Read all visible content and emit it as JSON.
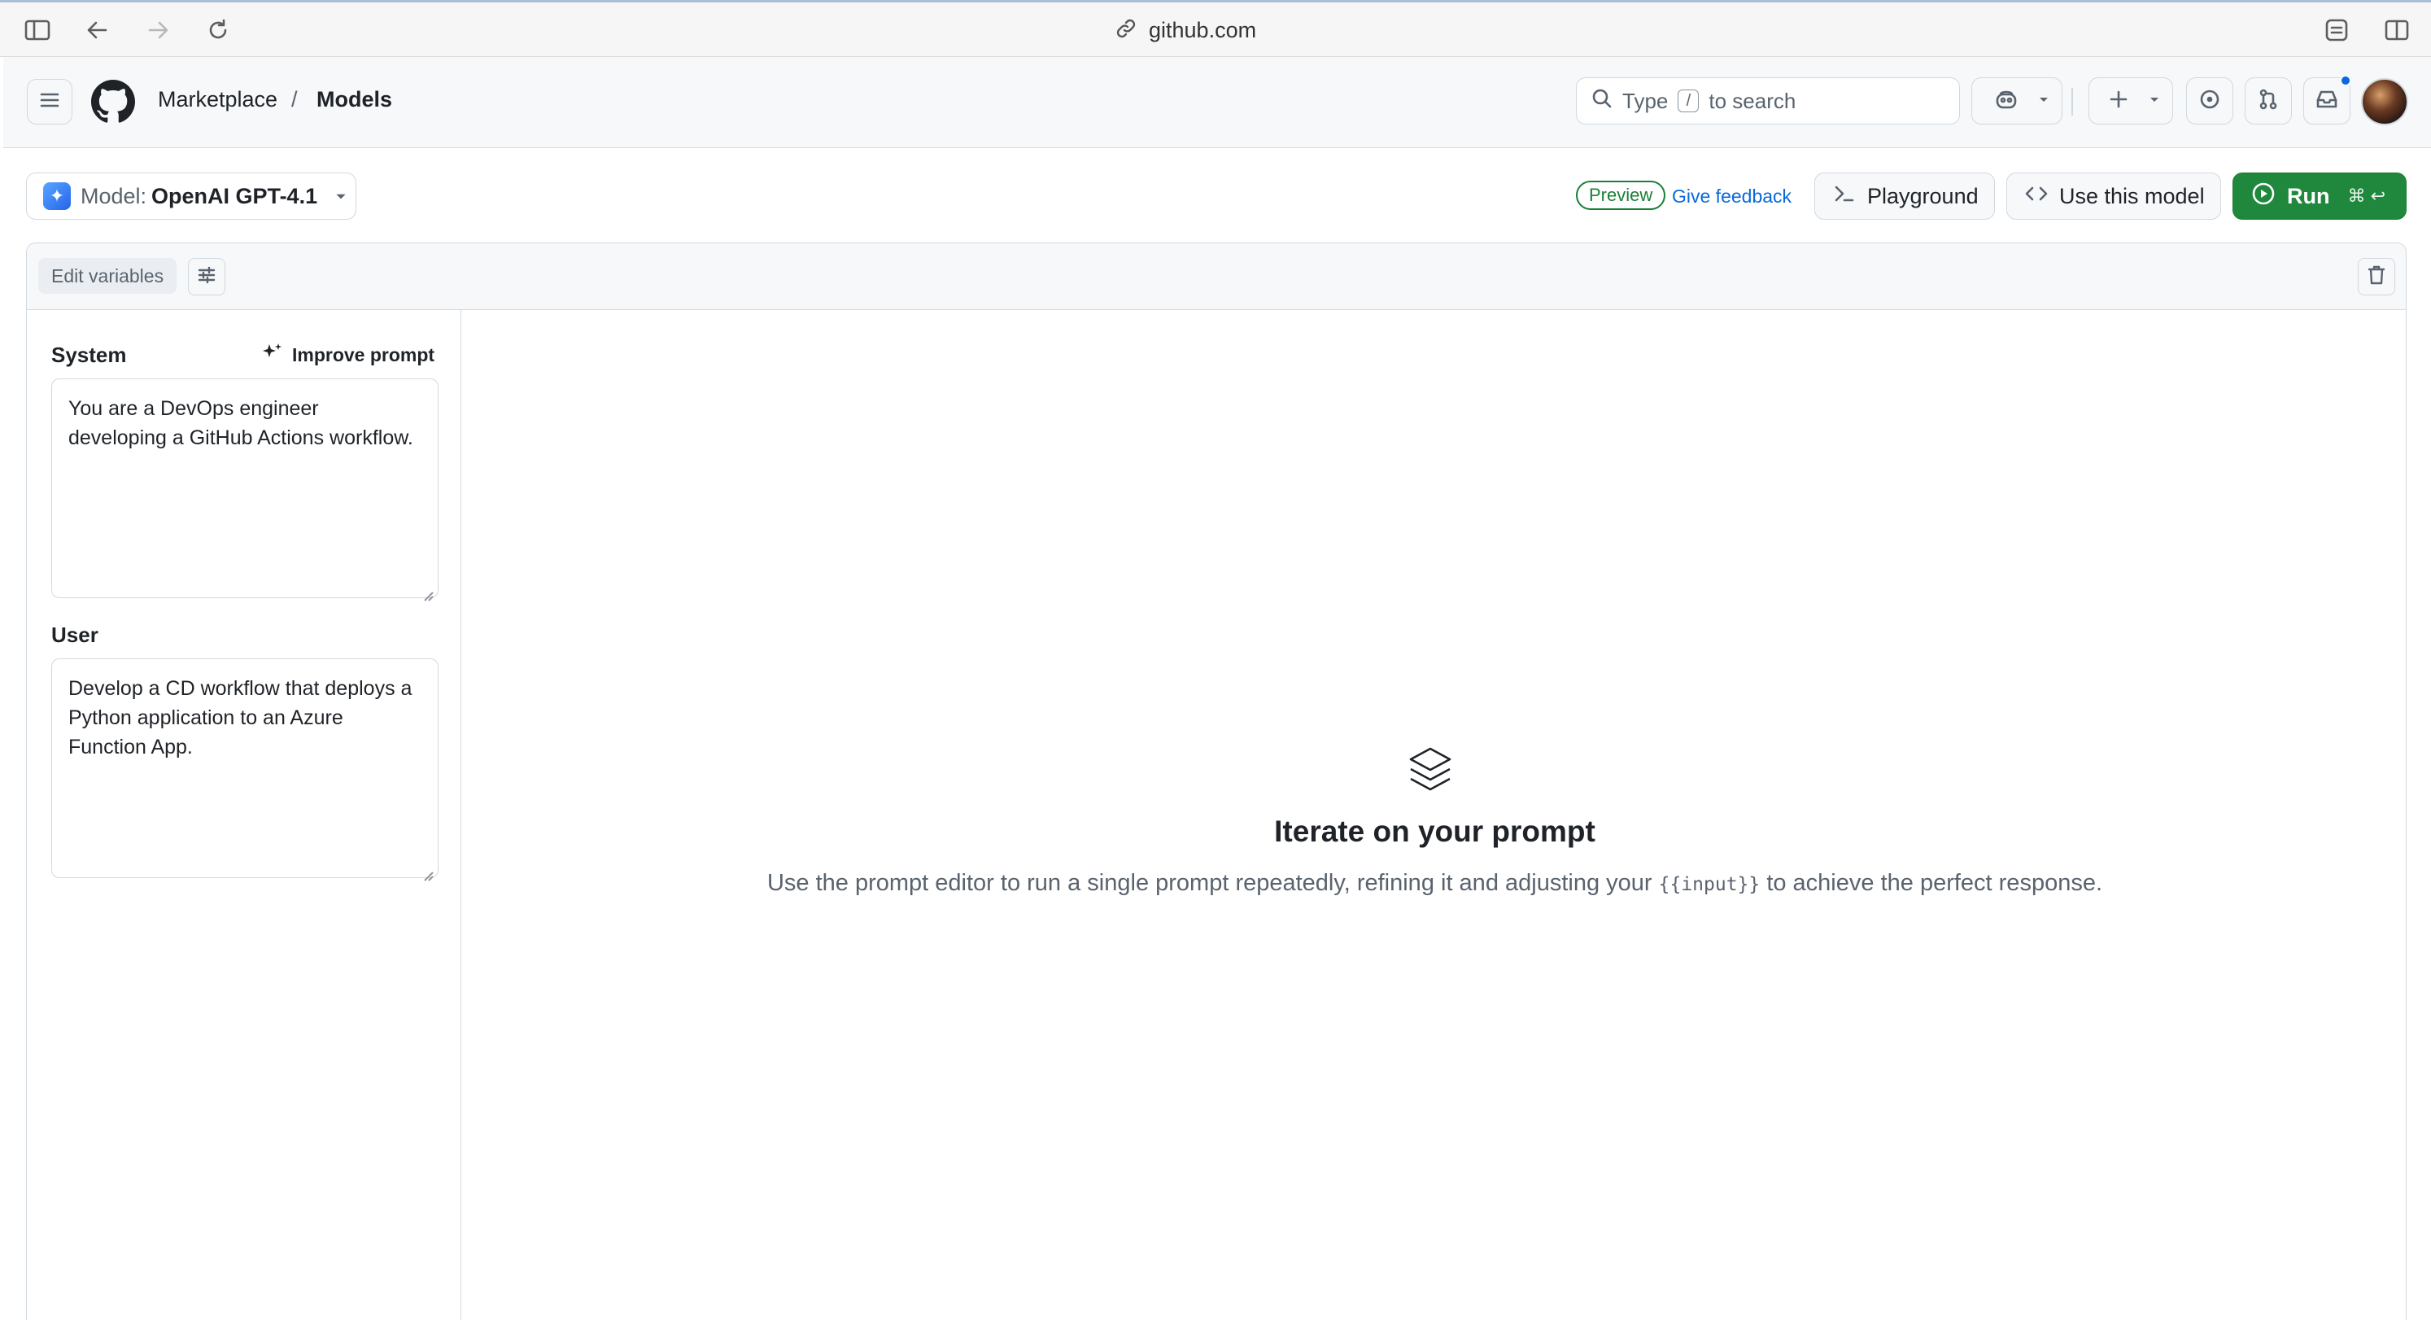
{
  "browser": {
    "url": "github.com"
  },
  "header": {
    "breadcrumb_parent": "Marketplace",
    "breadcrumb_separator": "/",
    "breadcrumb_current": "Models",
    "search_prefix": "Type",
    "search_key": "/",
    "search_suffix": "to search"
  },
  "toolbar": {
    "model_prefix": "Model:",
    "model_name": "OpenAI GPT-4.1",
    "preview_badge": "Preview",
    "feedback_link": "Give feedback",
    "playground_label": "Playground",
    "use_model_label": "Use this model",
    "run_label": "Run",
    "run_shortcut": "⌘ ↩"
  },
  "editor": {
    "edit_variables_label": "Edit variables",
    "system_label": "System",
    "improve_prompt_label": "Improve prompt",
    "system_text": "You are a DevOps engineer developing a GitHub Actions workflow.",
    "user_label": "User",
    "user_text": "Develop a CD workflow that deploys a Python application to an Azure Function App."
  },
  "empty_state": {
    "title": "Iterate on your prompt",
    "desc_before": "Use the prompt editor to run a single prompt repeatedly, refining it and adjusting your",
    "desc_code": "{{input}}",
    "desc_after": "to achieve the perfect response."
  },
  "colors": {
    "accent_blue": "#0969da",
    "run_green": "#1f883d",
    "border": "#d1d9e0",
    "muted_text": "#59636e"
  }
}
